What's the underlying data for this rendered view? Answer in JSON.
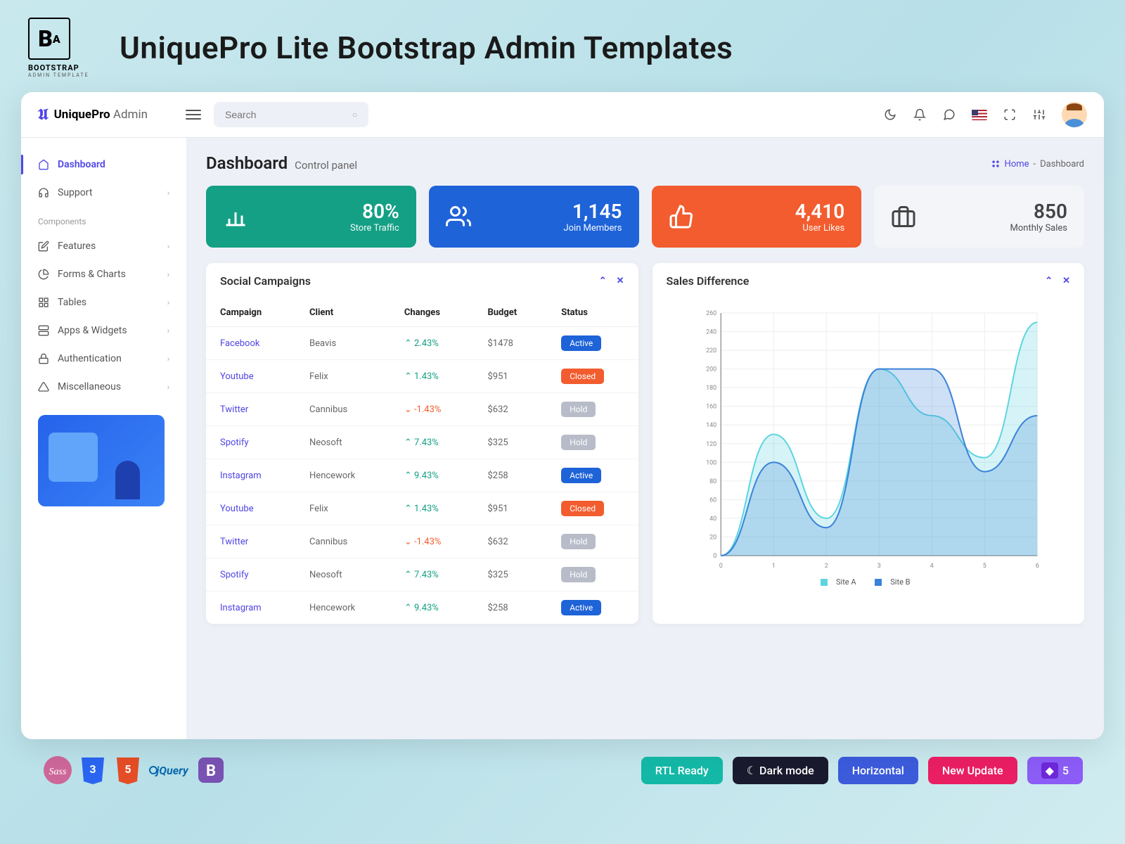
{
  "promo": {
    "title": "UniquePro Lite Bootstrap Admin Templates",
    "logo_main": "BOOTSTRAP",
    "logo_sub": "ADMIN TEMPLATE"
  },
  "header": {
    "brand_prefix": "UniquePro",
    "brand_suffix": "Admin",
    "search_placeholder": "Search"
  },
  "sidebar": {
    "items": [
      {
        "label": "Dashboard",
        "active": true
      },
      {
        "label": "Support"
      }
    ],
    "section": "Components",
    "comp_items": [
      {
        "label": "Features"
      },
      {
        "label": "Forms & Charts"
      },
      {
        "label": "Tables"
      },
      {
        "label": "Apps & Widgets"
      },
      {
        "label": "Authentication"
      },
      {
        "label": "Miscellaneous"
      }
    ]
  },
  "page": {
    "title": "Dashboard",
    "subtitle": "Control panel",
    "crumb_home": "Home",
    "crumb_current": "Dashboard",
    "crumb_sep": "-"
  },
  "stats": [
    {
      "value": "80%",
      "label": "Store Traffic"
    },
    {
      "value": "1,145",
      "label": "Join Members"
    },
    {
      "value": "4,410",
      "label": "User Likes"
    },
    {
      "value": "850",
      "label": "Monthly Sales"
    }
  ],
  "campaigns": {
    "title": "Social Campaigns",
    "cols": [
      "Campaign",
      "Client",
      "Changes",
      "Budget",
      "Status"
    ],
    "rows": [
      {
        "campaign": "Facebook",
        "client": "Beavis",
        "dir": "up",
        "change": "2.43%",
        "budget": "$1478",
        "status": "Active"
      },
      {
        "campaign": "Youtube",
        "client": "Felix",
        "dir": "up",
        "change": "1.43%",
        "budget": "$951",
        "status": "Closed"
      },
      {
        "campaign": "Twitter",
        "client": "Cannibus",
        "dir": "down",
        "change": "-1.43%",
        "budget": "$632",
        "status": "Hold"
      },
      {
        "campaign": "Spotify",
        "client": "Neosoft",
        "dir": "up",
        "change": "7.43%",
        "budget": "$325",
        "status": "Hold"
      },
      {
        "campaign": "Instagram",
        "client": "Hencework",
        "dir": "up",
        "change": "9.43%",
        "budget": "$258",
        "status": "Active"
      },
      {
        "campaign": "Youtube",
        "client": "Felix",
        "dir": "up",
        "change": "1.43%",
        "budget": "$951",
        "status": "Closed"
      },
      {
        "campaign": "Twitter",
        "client": "Cannibus",
        "dir": "down",
        "change": "-1.43%",
        "budget": "$632",
        "status": "Hold"
      },
      {
        "campaign": "Spotify",
        "client": "Neosoft",
        "dir": "up",
        "change": "7.43%",
        "budget": "$325",
        "status": "Hold"
      },
      {
        "campaign": "Instagram",
        "client": "Hencework",
        "dir": "up",
        "change": "9.43%",
        "budget": "$258",
        "status": "Active"
      }
    ]
  },
  "sales": {
    "title": "Sales Difference",
    "legend_a": "Site A",
    "legend_b": "Site B"
  },
  "chart_data": {
    "type": "area",
    "x": [
      0,
      1,
      2,
      3,
      4,
      5,
      6
    ],
    "series": [
      {
        "name": "Site A",
        "values": [
          0,
          130,
          40,
          200,
          150,
          105,
          250
        ],
        "color": "#5dd5e0"
      },
      {
        "name": "Site B",
        "values": [
          0,
          100,
          30,
          200,
          200,
          90,
          150
        ],
        "color": "#3b82d9"
      }
    ],
    "ylim": [
      0,
      260
    ],
    "yticks": [
      0,
      20,
      40,
      60,
      80,
      100,
      120,
      140,
      160,
      180,
      200,
      220,
      240,
      260
    ],
    "xticks": [
      0,
      1,
      2,
      3,
      4,
      5,
      6
    ]
  },
  "footer_btns": [
    {
      "label": "RTL Ready",
      "bg": "#14b8a6"
    },
    {
      "label": "Dark mode",
      "bg": "#1a1a2e",
      "icon": "moon"
    },
    {
      "label": "Horizontal",
      "bg": "#3b5bdb"
    },
    {
      "label": "New Update",
      "bg": "#e91e63"
    },
    {
      "label": "5",
      "bg": "#8b5cf6",
      "icon": "bootstrap"
    }
  ]
}
